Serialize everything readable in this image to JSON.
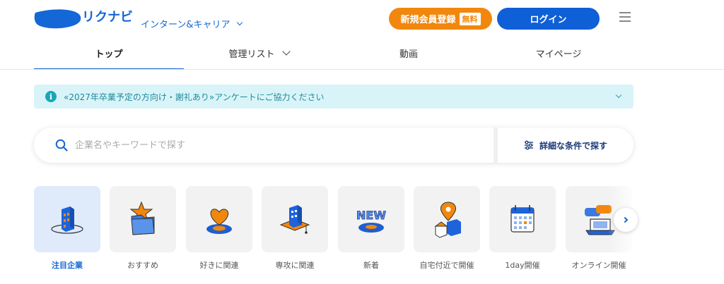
{
  "header": {
    "logo_text": "リクナビ",
    "category": "インターン&キャリア",
    "register_label": "新規会員登録",
    "free_badge": "無料",
    "login_label": "ログイン"
  },
  "nav": {
    "tabs": [
      {
        "label": "トップ"
      },
      {
        "label": "管理リスト"
      },
      {
        "label": "動画"
      },
      {
        "label": "マイページ"
      }
    ]
  },
  "notice": {
    "text": "«2027年卒業予定の方向け・謝礼あり»アンケートにご協力ください"
  },
  "search": {
    "placeholder": "企業名やキーワードで探す",
    "detail_label": "詳細な条件で探す"
  },
  "categories": [
    {
      "label": "注目企業",
      "icon": "building-icon"
    },
    {
      "label": "おすすめ",
      "icon": "star-folder-icon"
    },
    {
      "label": "好きに関連",
      "icon": "heart-icon"
    },
    {
      "label": "専攻に関連",
      "icon": "graduation-building-icon"
    },
    {
      "label": "新着",
      "icon": "new-badge-icon"
    },
    {
      "label": "自宅付近で開催",
      "icon": "map-pin-icon"
    },
    {
      "label": "1day開催",
      "icon": "calendar-icon"
    },
    {
      "label": "オンライン開催",
      "icon": "laptop-chat-icon"
    }
  ],
  "colors": {
    "brand_blue": "#1467d6",
    "register_orange": "#f2870d",
    "login_blue": "#0f5fd6",
    "notice_bg": "#d9f4f8"
  }
}
